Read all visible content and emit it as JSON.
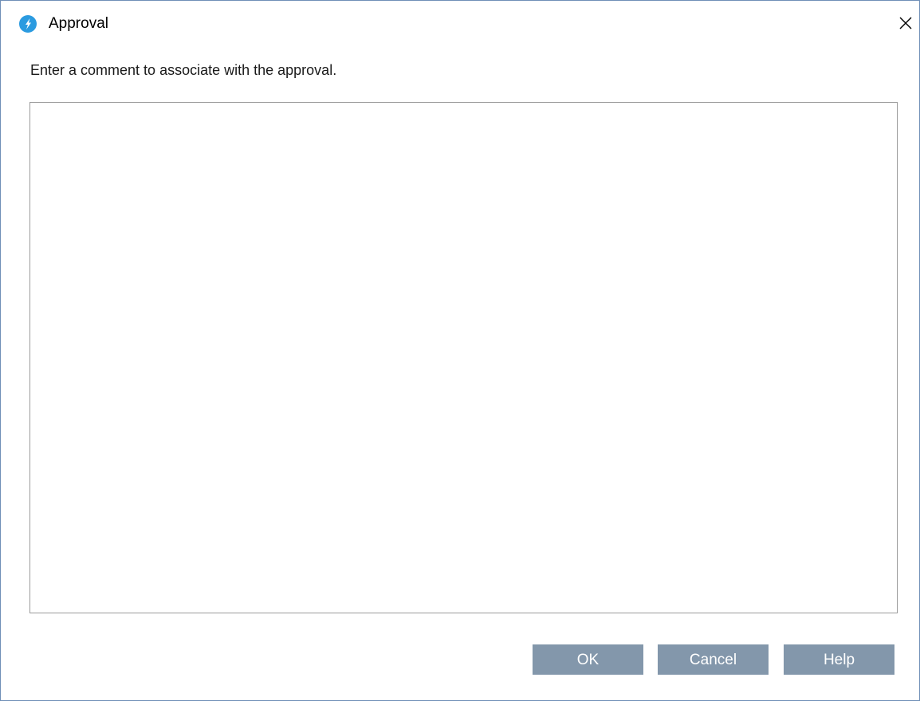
{
  "window": {
    "title": "Approval",
    "app_icon": "app-logo-icon",
    "close_icon": "close-icon"
  },
  "prompt": {
    "text": "Enter a comment to associate with the approval."
  },
  "comment": {
    "value": "",
    "placeholder": ""
  },
  "buttons": {
    "ok_label": "OK",
    "cancel_label": "Cancel",
    "help_label": "Help"
  },
  "colors": {
    "button_bg": "#8397ab",
    "button_text": "#ffffff",
    "icon_blue": "#2b9be0",
    "window_border": "#6f8fb7"
  }
}
